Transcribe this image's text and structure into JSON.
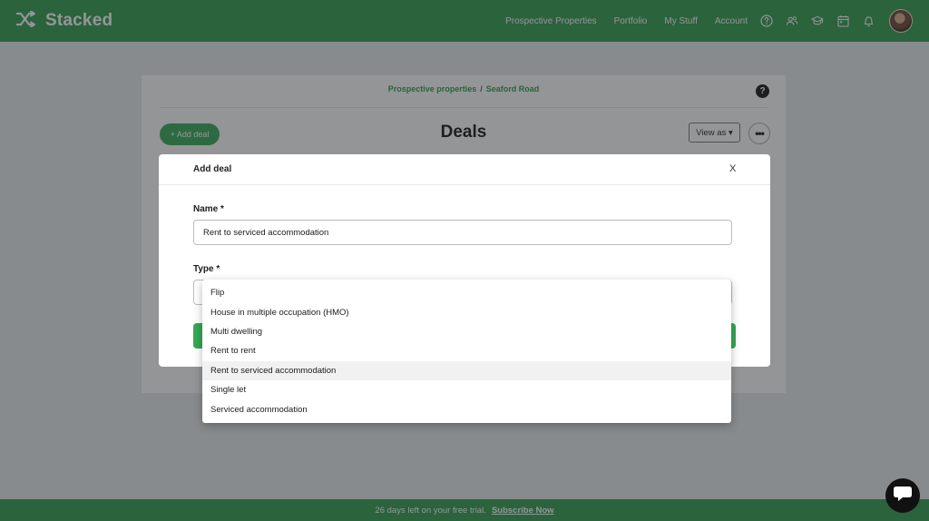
{
  "brand": {
    "name": "Stacked",
    "logo_icon": "shuffle-icon"
  },
  "nav": {
    "links": [
      "Prospective Properties",
      "Portfolio",
      "My Stuff",
      "Account"
    ],
    "icons": [
      "help-circle-icon",
      "users-icon",
      "graduation-cap-icon",
      "calendar-icon",
      "bell-icon"
    ]
  },
  "page": {
    "breadcrumb": {
      "parent": "Prospective properties",
      "separator": "/",
      "current": "Seaford Road"
    },
    "help_label": "?",
    "add_deal_label": "+ Add deal",
    "title": "Deals",
    "view_as_label": "View as ▾",
    "more_label": "•••"
  },
  "modal": {
    "title": "Add deal",
    "close_label": "X",
    "name_label": "Name *",
    "name_value": "Rent to serviced accommodation",
    "type_label": "Type *"
  },
  "dropdown": {
    "options": [
      "Flip",
      "House in multiple occupation (HMO)",
      "Multi dwelling",
      "Rent to rent",
      "Rent to serviced accommodation",
      "Single let",
      "Serviced accommodation"
    ],
    "selected": "Rent to serviced accommodation"
  },
  "trial": {
    "message": "26 days left on your free trial.",
    "cta": "Subscribe Now"
  },
  "colors": {
    "brand_green": "#2e9a49",
    "button_green": "#35a853"
  }
}
